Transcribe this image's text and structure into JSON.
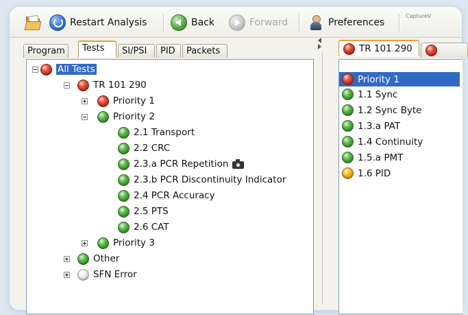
{
  "toolbar": {
    "restart_label": "Restart Analysis",
    "back_label": "Back",
    "forward_label": "Forward",
    "preferences_label": "Preferences",
    "capture_label": "CaptureV"
  },
  "left_tabs": [
    "Program",
    "Tests",
    "SI/PSI",
    "PID",
    "Packets"
  ],
  "left_active_tab": "Tests",
  "tree": {
    "all_tests": "All Tests",
    "tr101290": "TR 101 290",
    "priority1": "Priority 1",
    "priority2": "Priority 2",
    "p2_items": [
      "2.1 Transport",
      "2.2 CRC",
      "2.3.a PCR Repetition",
      "2.3.b PCR Discontinuity Indicator",
      "2.4 PCR Accuracy",
      "2.5 PTS",
      "2.6 CAT"
    ],
    "priority3": "Priority 3",
    "other": "Other",
    "sfn_error": "SFN Error"
  },
  "right_tabs": [
    "TR 101 290",
    ""
  ],
  "right_list": [
    {
      "label": "Priority 1",
      "status": "red"
    },
    {
      "label": "1.1 Sync",
      "status": "green"
    },
    {
      "label": "1.2 Sync Byte",
      "status": "green"
    },
    {
      "label": "1.3.a PAT",
      "status": "green"
    },
    {
      "label": "1.4 Continuity",
      "status": "green"
    },
    {
      "label": "1.5.a PMT",
      "status": "green"
    },
    {
      "label": "1.6 PID",
      "status": "yellow"
    }
  ],
  "colors": {
    "status_red": "#c8321f",
    "status_green": "#4fa53a",
    "status_yellow": "#f0ad1e",
    "status_white": "#e6e6e6",
    "selection": "#316ac5",
    "tab_accent": "#e9a233"
  }
}
